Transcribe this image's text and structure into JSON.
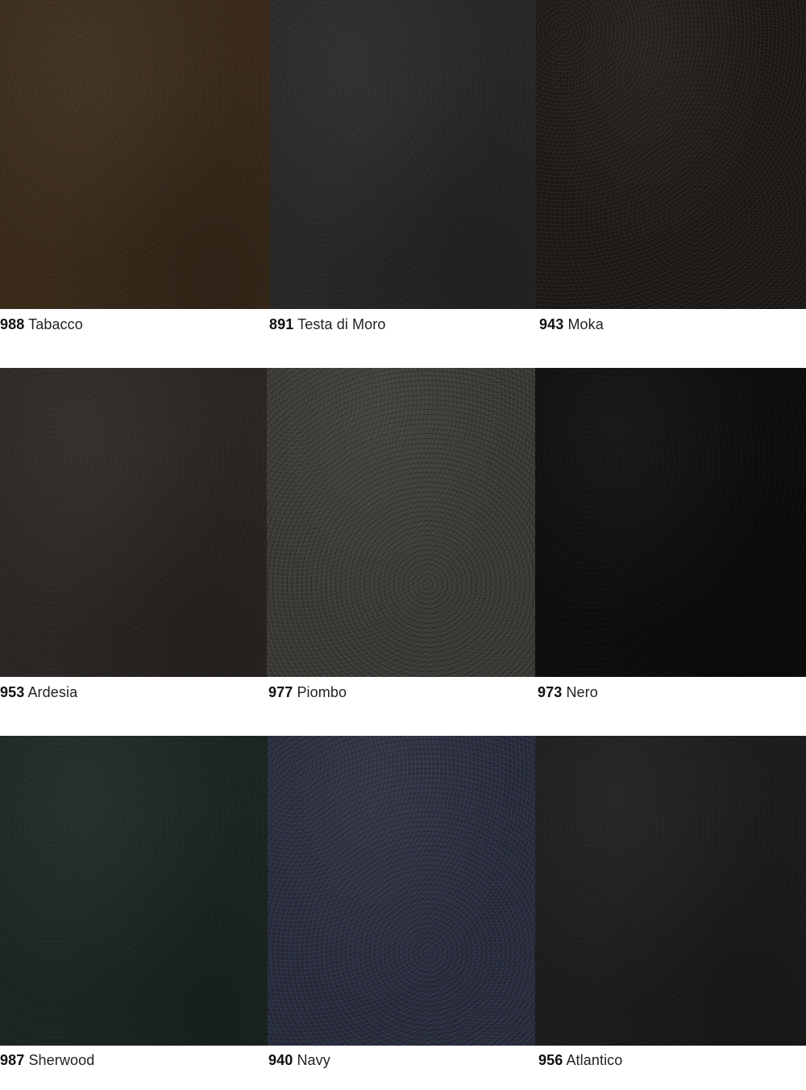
{
  "swatches": [
    {
      "code": "988",
      "name": "Tabacco",
      "color": "#392a1b",
      "texture": "smooth"
    },
    {
      "code": "891",
      "name": "Testa di Moro",
      "color": "#292725",
      "texture": "smooth"
    },
    {
      "code": "943",
      "name": "Moka",
      "color": "#1b1816",
      "texture": "pebbled"
    },
    {
      "code": "953",
      "name": "Ardesia",
      "color": "#2a2624",
      "texture": "smooth"
    },
    {
      "code": "977",
      "name": "Piombo",
      "color": "#3a3834",
      "texture": "pebbled"
    },
    {
      "code": "973",
      "name": "Nero",
      "color": "#0d0d0d",
      "texture": "smooth"
    },
    {
      "code": "987",
      "name": "Sherwood",
      "color": "#1c2621",
      "texture": "smooth"
    },
    {
      "code": "940",
      "name": "Navy",
      "color": "#272c3d",
      "texture": "pebbled"
    },
    {
      "code": "956",
      "name": "Atlantico",
      "color": "#1c1c1d",
      "texture": "smooth"
    }
  ]
}
